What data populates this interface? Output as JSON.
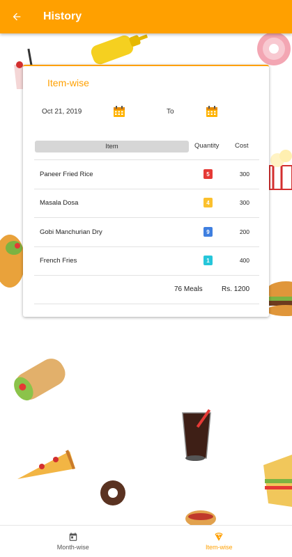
{
  "appbar": {
    "title": "History",
    "back_icon": "arrow-back-icon",
    "color": "#FFA000"
  },
  "card": {
    "title": "Item-wise",
    "from_date": "Oct 21, 2019",
    "to_label": "To",
    "calendar_icon": "calendar-icon"
  },
  "table": {
    "headers": {
      "item": "Item",
      "quantity": "Quantity",
      "cost": "Cost"
    },
    "rows": [
      {
        "name": "Paneer Fried Rice",
        "quantity": "5",
        "cost": "300",
        "badge_color": "#E53935"
      },
      {
        "name": "Masala Dosa",
        "quantity": "4",
        "cost": "300",
        "badge_color": "#FBC02D"
      },
      {
        "name": "Gobi Manchurian Dry",
        "quantity": "9",
        "cost": "200",
        "badge_color": "#3F7FE0"
      },
      {
        "name": "French Fries",
        "quantity": "1",
        "cost": "400",
        "badge_color": "#26C6DA"
      }
    ],
    "total_meals": "76 Meals",
    "total_cost": "Rs. 1200"
  },
  "bottom_nav": {
    "items": [
      {
        "label": "Month-wise",
        "icon": "calendar-icon",
        "active": false
      },
      {
        "label": "Item-wise",
        "icon": "pizza-icon",
        "active": true
      }
    ],
    "active_color": "#FFA000"
  }
}
